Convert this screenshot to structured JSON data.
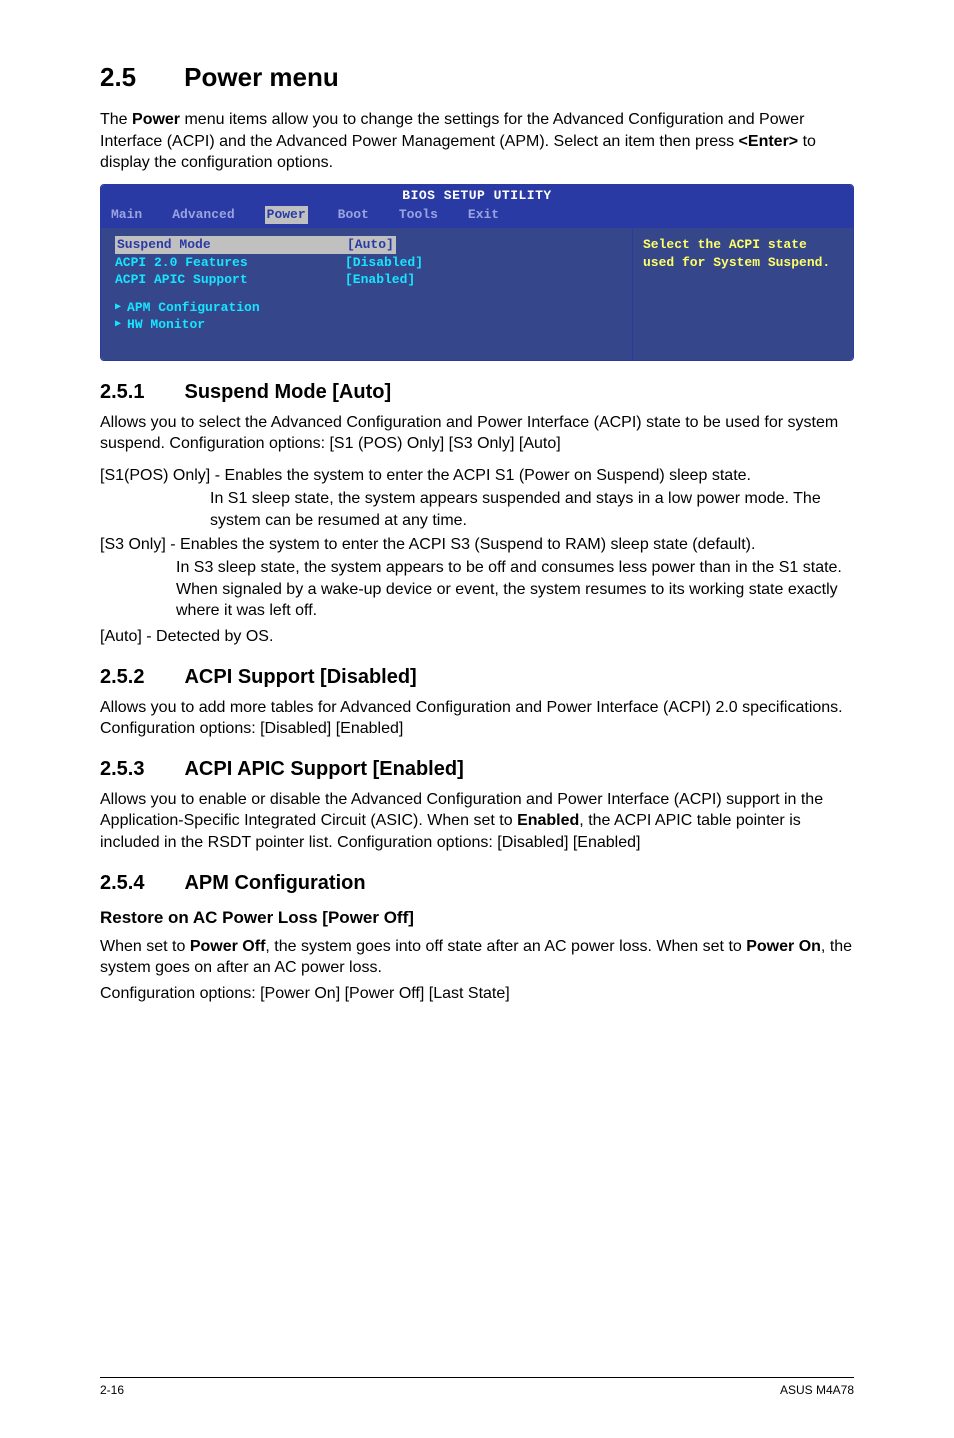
{
  "title": {
    "num": "2.5",
    "text": "Power menu"
  },
  "intro_html": "The <b>Power</b> menu items allow you to change the settings for the Advanced Configuration and Power Interface (ACPI) and the Advanced Power Management (APM). Select an item then press <b>&lt;Enter&gt;</b> to display the configuration options.",
  "bios": {
    "header_title": "BIOS SETUP UTILITY",
    "tabs": [
      "Main",
      "Advanced",
      "Power",
      "Boot",
      "Tools",
      "Exit"
    ],
    "rows": [
      {
        "label": "Suspend Mode",
        "value": "[Auto]",
        "selected": true
      },
      {
        "label": "ACPI 2.0 Features",
        "value": "[Disabled]",
        "selected": false
      },
      {
        "label": "ACPI APIC Support",
        "value": "[Enabled]",
        "selected": false
      }
    ],
    "sublist": [
      "APM Configuration",
      "HW Monitor"
    ],
    "help": "Select the ACPI state used for System Suspend."
  },
  "s251": {
    "num": "2.5.1",
    "title": "Suspend Mode [Auto]",
    "p1": "Allows you to select the Advanced Configuration and Power Interface (ACPI) state to be used for system suspend. Configuration options: [S1 (POS) Only] [S3 Only] [Auto]",
    "p2": "[S1(POS) Only] - Enables the system to enter the ACPI S1 (Power on Suspend) sleep state.",
    "p2a": "In S1 sleep state, the system appears suspended and stays in a low power mode. The system can be resumed at any time.",
    "p3": "[S3 Only] - Enables the system to enter the ACPI S3 (Suspend to RAM) sleep state (default).",
    "p3a": "In S3 sleep state, the system appears to be off and consumes less power than in the S1 state. When signaled by a wake-up device or event, the system resumes to its working state exactly where it was left off.",
    "p4": "[Auto] - Detected by OS."
  },
  "s252": {
    "num": "2.5.2",
    "title": "ACPI Support [Disabled]",
    "p": "Allows you to add more tables for Advanced Configuration and Power Interface (ACPI) 2.0 specifications. Configuration options: [Disabled] [Enabled]"
  },
  "s253": {
    "num": "2.5.3",
    "title": "ACPI APIC Support [Enabled]",
    "p_html": "Allows you to enable or disable the Advanced Configuration and Power Interface (ACPI) support in the Application-Specific Integrated Circuit (ASIC). When set to <b>Enabled</b>, the ACPI APIC table pointer is included in the RSDT pointer list. Configuration options: [Disabled] [Enabled]"
  },
  "s254": {
    "num": "2.5.4",
    "title": "APM Configuration",
    "sub": "Restore on AC Power Loss [Power Off]",
    "p_html": "When set to <b>Power Off</b>, the system goes into off state after an AC power loss. When set to <b>Power On</b>, the system goes on after an AC power loss.",
    "p2": "Configuration options: [Power On] [Power Off] [Last State]"
  },
  "footer": {
    "left": "2-16",
    "right": "ASUS M4A78"
  }
}
